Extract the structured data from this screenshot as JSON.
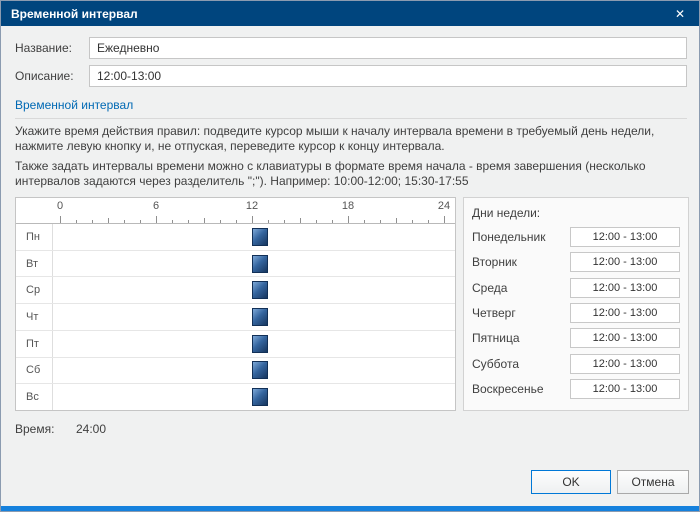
{
  "window": {
    "title": "Временной интервал",
    "close_glyph": "✕"
  },
  "form": {
    "name_label": "Название:",
    "name_value": "Ежедневно",
    "desc_label": "Описание:",
    "desc_value": "12:00-13:00"
  },
  "section": {
    "title": "Временной интервал"
  },
  "instructions": {
    "p1": "Укажите время действия правил: подведите курсор мыши к началу интервала времени в требуемый день недели, нажмите левую кнопку и, не отпуская, переведите курсор к концу интервала.",
    "p2": "Также задать интервалы времени можно с клавиатуры в формате время начала - время завершения (несколько интервалов задаются через разделитель \";\"). Например: 10:00-12:00; 15:30-17:55"
  },
  "grid": {
    "hour_labels": [
      "0",
      "6",
      "12",
      "18",
      "24"
    ],
    "axis_max": 24,
    "days": [
      "Пн",
      "Вт",
      "Ср",
      "Чт",
      "Пт",
      "Сб",
      "Вс"
    ],
    "interval_start": 12,
    "interval_end": 13
  },
  "days_panel": {
    "title": "Дни недели:",
    "rows": [
      {
        "day": "Понедельник",
        "value": "12:00 - 13:00"
      },
      {
        "day": "Вторник",
        "value": "12:00 - 13:00"
      },
      {
        "day": "Среда",
        "value": "12:00 - 13:00"
      },
      {
        "day": "Четверг",
        "value": "12:00 - 13:00"
      },
      {
        "day": "Пятница",
        "value": "12:00 - 13:00"
      },
      {
        "day": "Суббота",
        "value": "12:00 - 13:00"
      },
      {
        "day": "Воскресенье",
        "value": "12:00 - 13:00"
      }
    ]
  },
  "footer": {
    "time_label": "Время:",
    "time_value": "24:00",
    "ok_label": "OK",
    "cancel_label": "Отмена"
  },
  "colors": {
    "titlebar": "#00457e",
    "section_title": "#0069b4",
    "interval_block": "#35659f",
    "ok_border": "#0078d7",
    "bottom_strip": "#1581dd"
  }
}
